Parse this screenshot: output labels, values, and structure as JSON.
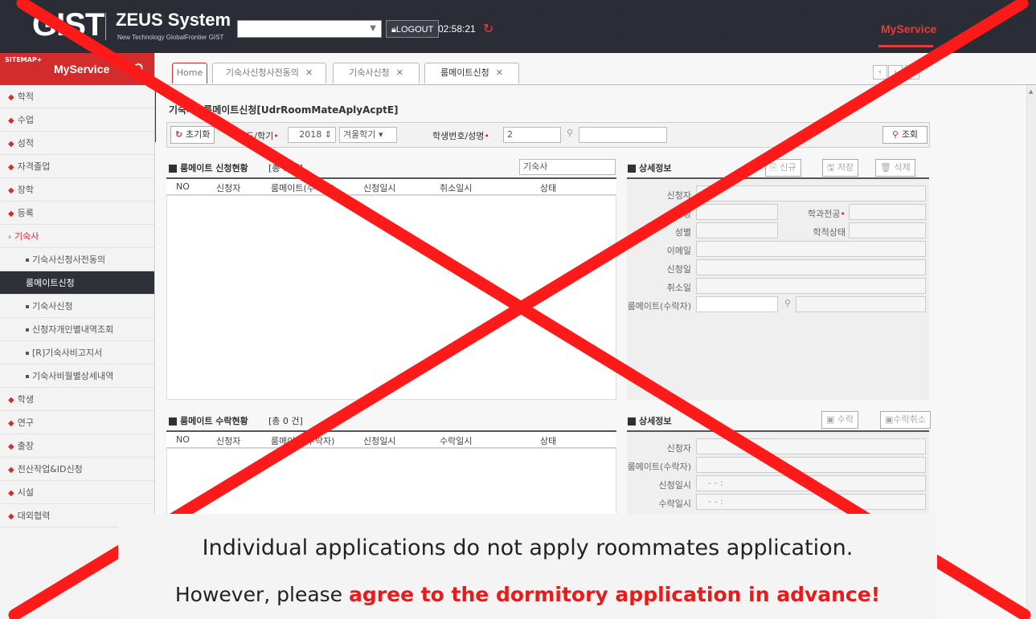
{
  "header": {
    "logo": "GIST",
    "system_name": "ZEUS System",
    "tagline": "New Technology GlobalFrontier GIST",
    "logout_label": "LOGOUT",
    "clock": "02:58:21",
    "myservice_label": "MyService"
  },
  "sidebar": {
    "sitemap_label": "SITEMAP+",
    "title": "MyService",
    "items": [
      {
        "label": "학적"
      },
      {
        "label": "수업"
      },
      {
        "label": "성적"
      },
      {
        "label": "자격졸업"
      },
      {
        "label": "장학"
      },
      {
        "label": "등록"
      },
      {
        "label": "기숙사"
      },
      {
        "label": "기숙사신청사전동의"
      },
      {
        "label": "룸메이트신청"
      },
      {
        "label": "기숙사신청"
      },
      {
        "label": "신청자개인별내역조회"
      },
      {
        "label": "[R]기숙사비고지서"
      },
      {
        "label": "기숙사비월별상세내역"
      },
      {
        "label": "학생"
      },
      {
        "label": "연구"
      },
      {
        "label": "출장"
      },
      {
        "label": "전산작업&ID신청"
      },
      {
        "label": "시설"
      },
      {
        "label": "대외협력"
      }
    ]
  },
  "tabs": [
    {
      "label": "Home"
    },
    {
      "label": "기숙사신청사전동의"
    },
    {
      "label": "기숙사신청"
    },
    {
      "label": "룸메이트신청"
    }
  ],
  "page": {
    "title": "기숙사>룸메이트신청[UdrRoomMateAplyAcptE]",
    "reset_label": "초기화",
    "year_label": "년도/학기",
    "year_value": "2018",
    "semester_value": "겨울학기",
    "student_label": "학생번호/성명",
    "student_value": "2",
    "search_label": "조회"
  },
  "apply_grid": {
    "title": "룸메이트 신청현황",
    "count_prefix": "[총",
    "count": "0 건]",
    "dorm_select": "기숙사",
    "columns": [
      "NO",
      "신청자",
      "룸메이트(수락자)",
      "신청일시",
      "취소일시",
      "상태"
    ]
  },
  "apply_detail": {
    "title": "상세정보",
    "new_label": "신규",
    "save_label": "저장",
    "delete_label": "삭제",
    "labels": [
      "신청자",
      "성명",
      "학과전공",
      "성별",
      "학적상태",
      "이메일",
      "신청일",
      "취소일",
      "룸메이트(수락자)"
    ]
  },
  "accept_grid": {
    "title": "룸메이트 수락현황",
    "count_prefix": "[총",
    "count": "0 건]",
    "columns": [
      "NO",
      "신청자",
      "룸메이트(수락자)",
      "신청일시",
      "수락일시",
      "상태"
    ]
  },
  "accept_detail": {
    "title": "상세정보",
    "accept_label": "수락",
    "cancel_label": "수락취소",
    "labels": [
      "신청자",
      "룸메이트(수락자)",
      "신청일시",
      "수락일시"
    ],
    "date_placeholder": "-   -     :"
  },
  "notice": {
    "line1": "Individual applications do not apply roommates application.",
    "line2_prefix": "However, please ",
    "line2_highlight": "agree to the dormitory application in advance!"
  },
  "colors": {
    "accent": "#d22c2c",
    "header_bg": "#2a2d35",
    "cross": "#ff1a1a"
  }
}
